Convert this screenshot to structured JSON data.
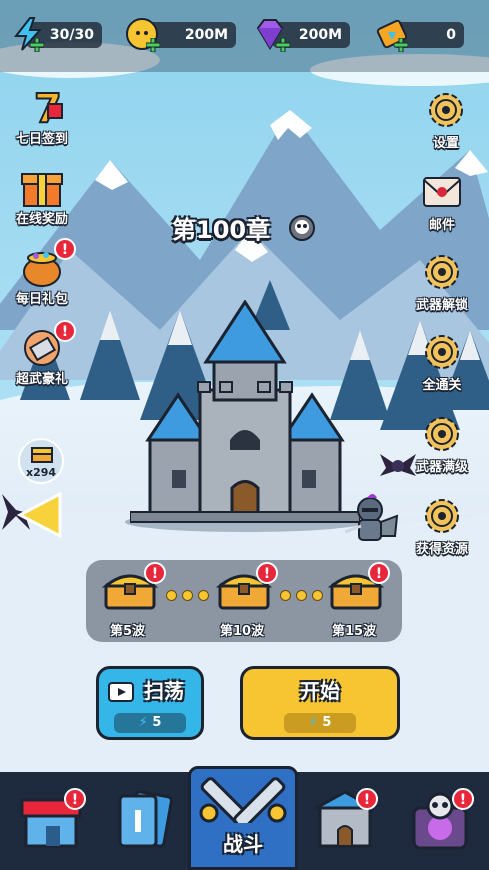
{
  "resources": {
    "energy": "30/30",
    "gold": "200M",
    "gems": "200M",
    "tickets": "0"
  },
  "left_menu": [
    {
      "label": "七日签到",
      "icon": "seven-day-calendar-icon",
      "number": "7",
      "badge": ""
    },
    {
      "label": "在线奖励",
      "icon": "gift-box-icon",
      "badge": ""
    },
    {
      "label": "每日礼包",
      "icon": "treasure-pot-icon",
      "badge": "!"
    },
    {
      "label": "超武豪礼",
      "icon": "weapon-gift-icon",
      "badge": "!"
    }
  ],
  "right_menu": [
    {
      "label": "设置",
      "icon": "gear-icon"
    },
    {
      "label": "邮件",
      "icon": "mail-icon"
    },
    {
      "label": "武器解锁",
      "icon": "gear-icon"
    },
    {
      "label": "全通关",
      "icon": "gear-icon"
    },
    {
      "label": "武器满级",
      "icon": "gear-icon"
    },
    {
      "label": "获得资源",
      "icon": "gear-icon"
    }
  ],
  "chapter": {
    "title": "第100章",
    "icon": "skull-icon"
  },
  "chest_counter": "x294",
  "waves": [
    {
      "label": "第5波",
      "badge": "!"
    },
    {
      "label": "第10波",
      "badge": "!"
    },
    {
      "label": "第15波",
      "badge": "!"
    }
  ],
  "sweep_button": {
    "label": "扫荡",
    "cost": "5",
    "color": "#35b6e8"
  },
  "start_button": {
    "label": "开始",
    "cost": "5",
    "color": "#f7c531"
  },
  "bottom_nav": [
    {
      "name": "shop",
      "icon": "shop-icon",
      "badge": "!"
    },
    {
      "name": "cards",
      "icon": "cards-icon",
      "badge": ""
    },
    {
      "name": "battle",
      "label": "战斗",
      "icon": "crossed-swords-icon"
    },
    {
      "name": "castle",
      "icon": "castle-icon",
      "badge": "!"
    },
    {
      "name": "skull",
      "icon": "skull-portal-icon",
      "badge": "!"
    }
  ]
}
